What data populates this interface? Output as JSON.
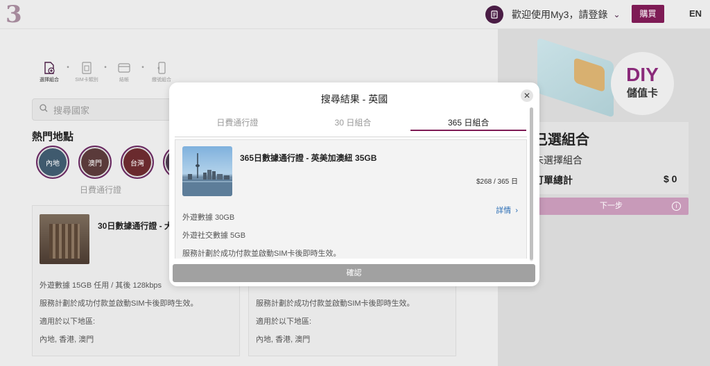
{
  "header": {
    "logo": "3",
    "welcome": "歡迎使用My3，請登錄",
    "buy": "購買",
    "lang": "EN"
  },
  "steps": [
    {
      "label": "選擇組合",
      "icon": "sim-plus-icon"
    },
    {
      "label": "SIM卡類別",
      "icon": "sim-card-icon"
    },
    {
      "label": "結帳",
      "icon": "payment-card-icon"
    },
    {
      "label": "繳號組合",
      "icon": "phone-icon"
    }
  ],
  "search": {
    "placeholder": "搜尋國家"
  },
  "hot": {
    "title": "熱門地點",
    "regions": [
      "內地",
      "澳門",
      "台灣"
    ]
  },
  "bg_tab": "日費通行證",
  "bg_cards": [
    {
      "title": "30日數據通行證 - 大",
      "lines": [
        "外遊數據 15GB 任用 / 其後 128kbps",
        "服務計劃於成功付款並啟動SIM卡後即時生效。",
        "適用於以下地區:",
        "內地, 香港, 澳門"
      ]
    },
    {
      "title": "",
      "lines": [
        "",
        "服務計劃於成功付款並啟動SIM卡後即時生效。",
        "適用於以下地區:",
        "內地, 香港, 澳門"
      ]
    }
  ],
  "right_panel": {
    "diy": "DIY",
    "diy_sub": "儲值卡",
    "title": "已選組合",
    "subtitle": "未選擇組合",
    "total_label": "訂單總計",
    "total_amount": "$ 0",
    "next": "下一步"
  },
  "modal": {
    "title": "搜尋結果 - 英國",
    "tabs": [
      "日費通行證",
      "30 日組合",
      "365 日組合"
    ],
    "active_tab": 2,
    "package": {
      "title": "365日數據通行證 - 英美加澳紐 35GB",
      "price": "$268 / 365 日",
      "detail": "詳情",
      "lines": [
        "外遊數據 30GB",
        "外遊社交數據 5GB",
        "服務計劃於成功付款並啟動SIM卡後即時生效。"
      ]
    },
    "confirm": "確認"
  },
  "colors": {
    "brand": "#7e1b55",
    "link": "#2a6db5"
  }
}
